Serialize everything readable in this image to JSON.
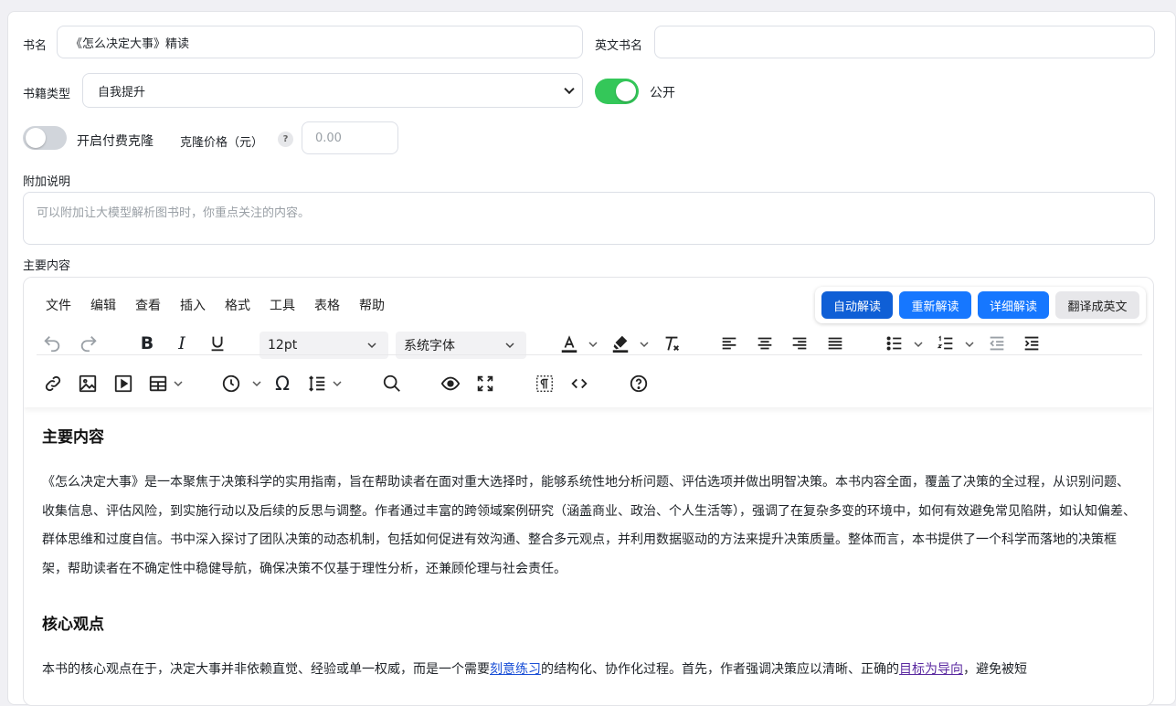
{
  "form": {
    "book_name_label": "书名",
    "book_name_value": "《怎么决定大事》精读",
    "english_name_label": "英文书名",
    "english_name_value": "",
    "category_label": "书籍类型",
    "category_value": "自我提升",
    "public_label": "公开",
    "public_on": true,
    "paid_clone_label": "开启付费克隆",
    "paid_clone_on": false,
    "clone_price_label": "克隆价格（元）",
    "clone_price_help": "?",
    "clone_price_placeholder": "0.00",
    "extra_label": "附加说明",
    "extra_placeholder": "可以附加让大模型解析图书时，你重点关注的内容。",
    "main_label": "主要内容"
  },
  "editor": {
    "menu": [
      "文件",
      "编辑",
      "查看",
      "插入",
      "格式",
      "工具",
      "表格",
      "帮助"
    ],
    "ai_buttons": [
      "自动解读",
      "重新解读",
      "详细解读",
      "翻译成英文"
    ],
    "font_size": "12pt",
    "font_family": "系统字体",
    "colors": {
      "accent": "#1677ff",
      "accent_dark": "#0f5fd6",
      "switch_on": "#34c759",
      "switch_off": "#d1d5db"
    }
  },
  "content": {
    "h1": "主要内容",
    "p1": "《怎么决定大事》是一本聚焦于决策科学的实用指南，旨在帮助读者在面对重大选择时，能够系统性地分析问题、评估选项并做出明智决策。本书内容全面，覆盖了决策的全过程，从识别问题、收集信息、评估风险，到实施行动以及后续的反思与调整。作者通过丰富的跨领域案例研究（涵盖商业、政治、个人生活等），强调了在复杂多变的环境中，如何有效避免常见陷阱，如认知偏差、群体思维和过度自信。书中深入探讨了团队决策的动态机制，包括如何促进有效沟通、整合多元观点，并利用数据驱动的方法来提升决策质量。整体而言，本书提供了一个科学而落地的决策框架，帮助读者在不确定性中稳健导航，确保决策不仅基于理性分析，还兼顾伦理与社会责任。",
    "h2": "核心观点",
    "p2_a": "本书的核心观点在于，决定大事并非依赖直觉、经验或单一权威，而是一个需要",
    "p2_link1": "刻意练习",
    "p2_b": "的结构化、协作化过程。首先，作者强调决策应以清晰、正确的",
    "p2_link2": "目标为导向",
    "p2_c": "，避免被短"
  }
}
